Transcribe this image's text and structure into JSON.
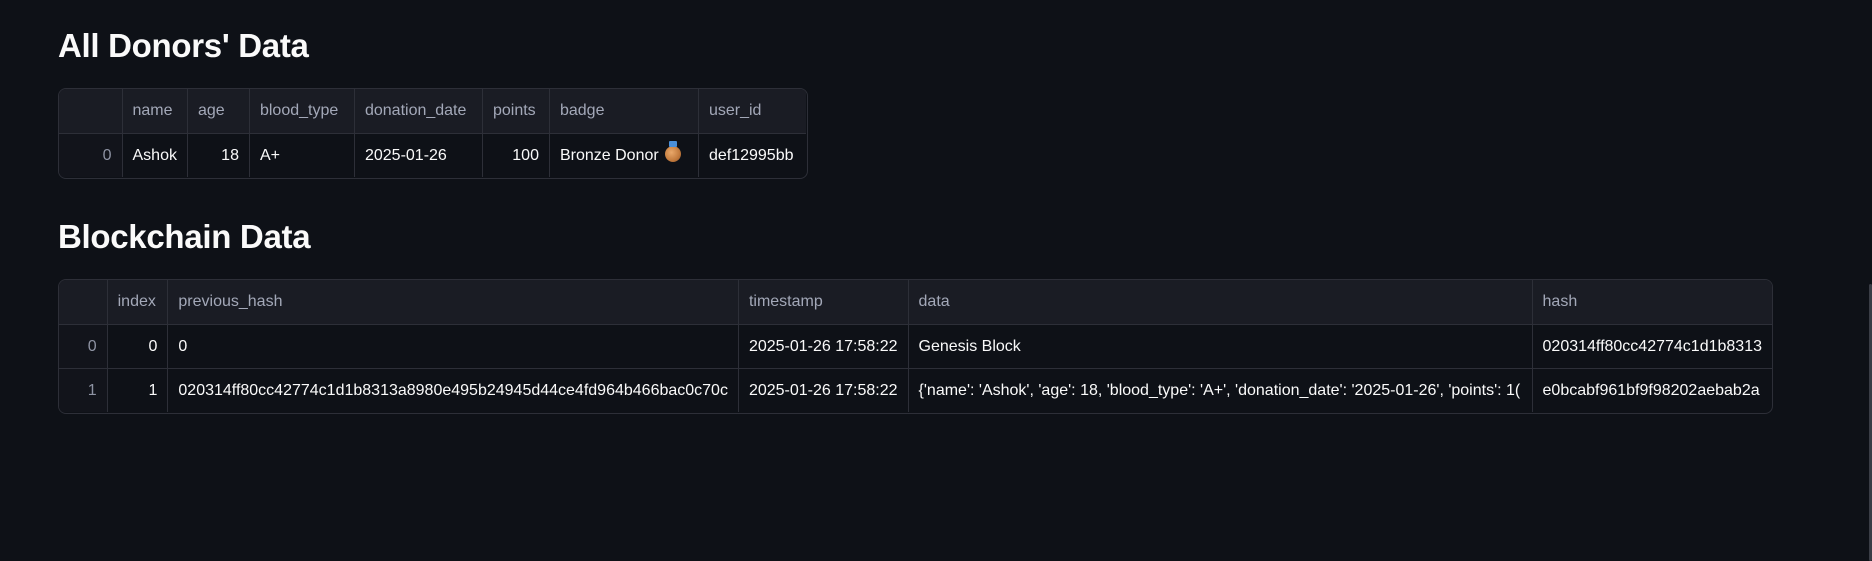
{
  "donors": {
    "title": "All Donors' Data",
    "columns": [
      "name",
      "age",
      "blood_type",
      "donation_date",
      "points",
      "badge",
      "user_id"
    ],
    "rows": [
      {
        "index": "0",
        "name": "Ashok",
        "age": "18",
        "blood_type": "A+",
        "donation_date": "2025-01-26",
        "points": "100",
        "badge": "Bronze Donor",
        "badge_icon": "bronze-medal-icon",
        "user_id": "def12995bb"
      }
    ]
  },
  "blockchain": {
    "title": "Blockchain Data",
    "columns": [
      "index",
      "previous_hash",
      "timestamp",
      "data",
      "hash"
    ],
    "rows": [
      {
        "row": "0",
        "index": "0",
        "previous_hash": "0",
        "timestamp": "2025-01-26 17:58:22",
        "data": "Genesis Block",
        "hash": "020314ff80cc42774c1d1b8313"
      },
      {
        "row": "1",
        "index": "1",
        "previous_hash": "020314ff80cc42774c1d1b8313a8980e495b24945d44ce4fd964b466bac0c70c",
        "timestamp": "2025-01-26 17:58:22",
        "data": "{'name': 'Ashok', 'age': 18, 'blood_type': 'A+', 'donation_date': '2025-01-26', 'points': 1(",
        "hash": "e0bcabf961bf9f98202aebab2a"
      }
    ]
  }
}
